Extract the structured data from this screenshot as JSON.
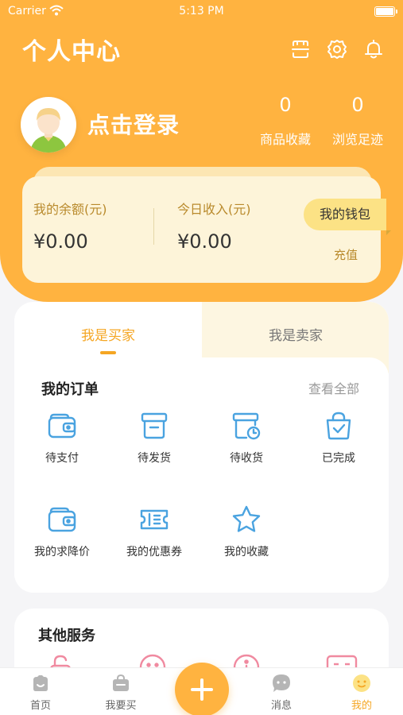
{
  "status_bar": {
    "carrier": "Carrier",
    "time": "5:13 PM"
  },
  "header": {
    "title": "个人中心",
    "icons": [
      "scan-icon",
      "gear-icon",
      "bell-icon"
    ]
  },
  "profile": {
    "login_text": "点击登录",
    "favorites_count": "0",
    "favorites_label": "商品收藏",
    "history_count": "0",
    "history_label": "浏览足迹"
  },
  "wallet": {
    "balance_label": "我的余额(元)",
    "balance_value": "¥0.00",
    "income_label": "今日收入(元)",
    "income_value": "¥0.00",
    "wallet_button": "我的钱包",
    "recharge_button": "充值"
  },
  "role_tabs": {
    "buyer": "我是买家",
    "seller": "我是卖家",
    "active": "buyer"
  },
  "orders": {
    "title": "我的订单",
    "view_all": "查看全部",
    "items": [
      {
        "label": "待支付",
        "icon": "wallet-icon"
      },
      {
        "label": "待发货",
        "icon": "package-icon"
      },
      {
        "label": "待收货",
        "icon": "receive-clock-icon"
      },
      {
        "label": "已完成",
        "icon": "bag-check-icon"
      },
      {
        "label": "我的求降价",
        "icon": "wallet-icon"
      },
      {
        "label": "我的优惠券",
        "icon": "coupon-icon"
      },
      {
        "label": "我的收藏",
        "icon": "star-icon"
      }
    ]
  },
  "services": {
    "title": "其他服务"
  },
  "tab_bar": {
    "items": [
      {
        "label": "首页",
        "icon": "home-icon"
      },
      {
        "label": "我要买",
        "icon": "shopping-bag-icon"
      },
      {
        "label": "",
        "icon": "plus-icon"
      },
      {
        "label": "消息",
        "icon": "message-icon"
      },
      {
        "label": "我的",
        "icon": "profile-icon"
      }
    ],
    "active": "我的"
  },
  "colors": {
    "primary": "#ffb340",
    "accent": "#f5a623",
    "icon_blue": "#4aa3e0",
    "wallet_bg": "#fdf4d9",
    "wallet_button_bg": "#fce285"
  }
}
